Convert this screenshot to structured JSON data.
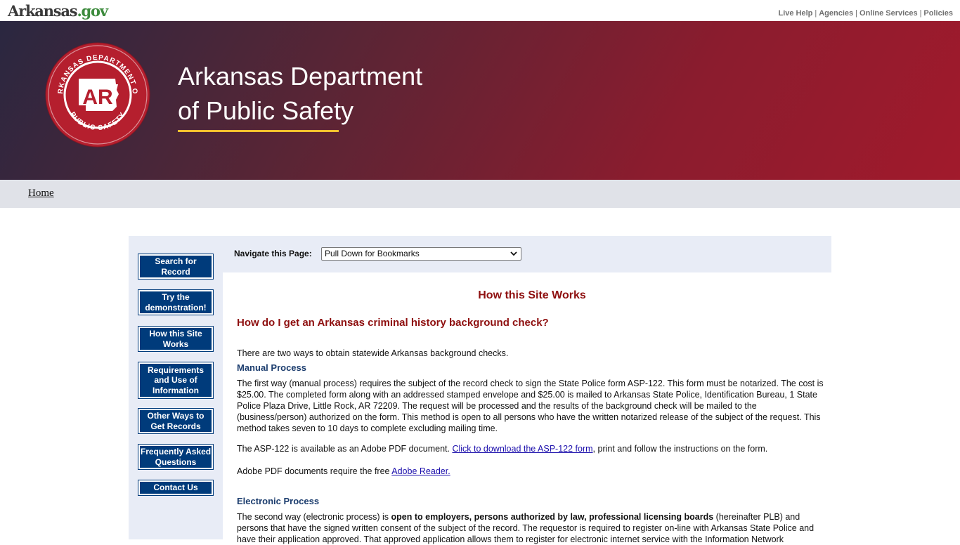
{
  "top": {
    "logo_ark": "Arkansas",
    "logo_gov": ".gov",
    "links": [
      "Live Help",
      "Agencies",
      "Online Services",
      "Policies"
    ]
  },
  "banner": {
    "title_line1": "Arkansas Department",
    "title_line2": "of Public Safety",
    "seal_top_text": "ARKANSAS DEPARTMENT OF",
    "seal_bottom_text": "PUBLIC SAFETY",
    "seal_center": "AR"
  },
  "breadcrumb": {
    "home": "Home"
  },
  "leftnav": [
    {
      "label": "Search for Record"
    },
    {
      "label": "Try the demonstration!"
    },
    {
      "label": "How this Site Works"
    },
    {
      "label": "Requirements and Use of Information"
    },
    {
      "label": "Other Ways to Get Records"
    },
    {
      "label": "Frequently Asked Questions"
    },
    {
      "label": "Contact Us"
    }
  ],
  "navpage": {
    "label": "Navigate this Page:",
    "select_value": "Pull Down for Bookmarks"
  },
  "content": {
    "heading": "How this Site Works",
    "question": "How do I get an Arkansas criminal history background check?",
    "intro": "There are two ways to obtain statewide Arkansas background checks.",
    "manual_heading": "Manual Process",
    "manual_p1": "The first way (manual process) requires the subject of the record check to sign the State Police form ASP-122. This form must be notarized. The cost is $25.00. The completed form along with an addressed stamped envelope and $25.00 is mailed to Arkansas State Police, Identification Bureau, 1 State Police Plaza Drive, Little Rock, AR 72209. The request will be processed and the results of the background check will be mailed to the (business/person) authorized on the form. This method is open to all persons who have the written notarized release of the subject of the request. This method takes seven to 10 days to complete excluding mailing time.",
    "asp_prefix": "The ASP-122 is available as an Adobe PDF document. ",
    "asp_link": "Click to download the ASP-122 form",
    "asp_suffix": ", print and follow the instructions on the form.",
    "adobe_prefix": "Adobe PDF documents require the free ",
    "adobe_link": "Adobe Reader.",
    "electronic_heading": "Electronic Process",
    "elec_prefix": "The second way (electronic process) is ",
    "elec_bold": "open to employers, persons authorized by law, professional licensing boards",
    "elec_suffix": " (hereinafter PLB) and persons that have the signed written consent of the subject of the record. The requestor is required to register on-line with Arkansas State Police and have their application approved. That approved application allows them to register for electronic internet service with the Information Network"
  }
}
